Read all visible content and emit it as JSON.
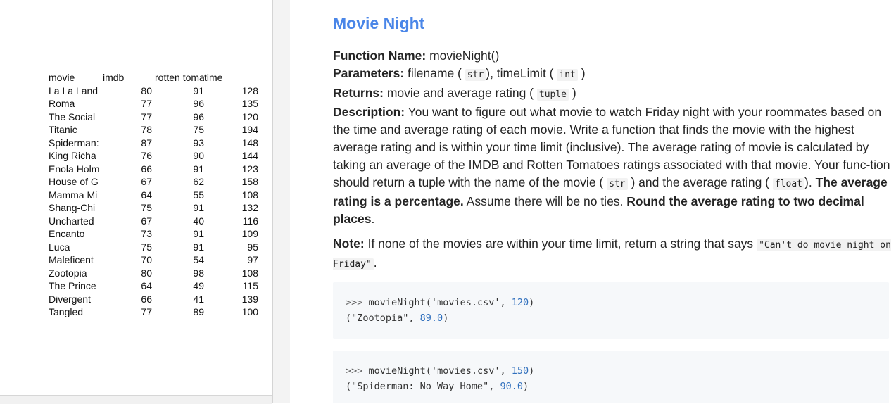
{
  "spreadsheet": {
    "columns": [
      "movie",
      "imdb",
      "rotten toma",
      "time"
    ],
    "rows": [
      [
        "La La Land",
        "80",
        "91",
        "128"
      ],
      [
        "Roma",
        "77",
        "96",
        "135"
      ],
      [
        "The Social",
        "77",
        "96",
        "120"
      ],
      [
        "Titanic",
        "78",
        "75",
        "194"
      ],
      [
        "Spiderman:",
        "87",
        "93",
        "148"
      ],
      [
        "King Richa",
        "76",
        "90",
        "144"
      ],
      [
        "Enola Holm",
        "66",
        "91",
        "123"
      ],
      [
        "House of G",
        "67",
        "62",
        "158"
      ],
      [
        "Mamma Mi",
        "64",
        "55",
        "108"
      ],
      [
        "Shang-Chi",
        "75",
        "91",
        "132"
      ],
      [
        "Uncharted",
        "67",
        "40",
        "116"
      ],
      [
        "Encanto",
        "73",
        "91",
        "109"
      ],
      [
        "Luca",
        "75",
        "91",
        "95"
      ],
      [
        "Maleficent",
        "70",
        "54",
        "97"
      ],
      [
        "Zootopia",
        "80",
        "98",
        "108"
      ],
      [
        "The Prince",
        "64",
        "49",
        "115"
      ],
      [
        "Divergent",
        "66",
        "41",
        "139"
      ],
      [
        "Tangled",
        "77",
        "89",
        "100"
      ]
    ]
  },
  "doc": {
    "title": "Movie Night",
    "function_label": "Function Name:",
    "function_value": "movieNight()",
    "params_label": "Parameters:",
    "params_text1": "filename (",
    "params_type1": "str",
    "params_text2": "), timeLimit (",
    "params_type2": "int",
    "params_text3": ")",
    "returns_label": "Returns:",
    "returns_text1": "movie and average rating (",
    "returns_type": "tuple",
    "returns_text2": ")",
    "desc_label": "Description:",
    "desc_text1": "You want to figure out what movie to watch Friday night with your roommates based on the time and average rating of each movie. Write a function that finds the movie with the highest average rating and is within your time limit (inclusive). The average rating of movie is calculated by taking an average of the IMDB and Rotten Tomatoes ratings associated with that movie. Your func-tion should return a tuple with the name of the movie (",
    "desc_type1": "str",
    "desc_text2": ") and the average rating (",
    "desc_type2": "float",
    "desc_text3": ").",
    "desc_bold1": "The average rating is a percentage.",
    "desc_text4": "Assume there will be no ties.",
    "desc_bold2": "Round the average rating to two decimal places",
    "desc_text5": ".",
    "note_label": "Note:",
    "note_text": "If none of the movies are within your time limit, return a string that says",
    "note_code": "\"Can't do movie night on Friday\"",
    "note_end": "."
  },
  "examples": [
    {
      "prompt": ">>>",
      "call_pre": "movieNight('movies.csv', ",
      "call_num": "120",
      "call_post": ")",
      "result_pre": "(\"Zootopia\", ",
      "result_num": "89.0",
      "result_post": ")"
    },
    {
      "prompt": ">>>",
      "call_pre": "movieNight('movies.csv', ",
      "call_num": "150",
      "call_post": ")",
      "result_pre": "(\"Spiderman: No Way Home\", ",
      "result_num": "90.0",
      "result_post": ")"
    }
  ]
}
